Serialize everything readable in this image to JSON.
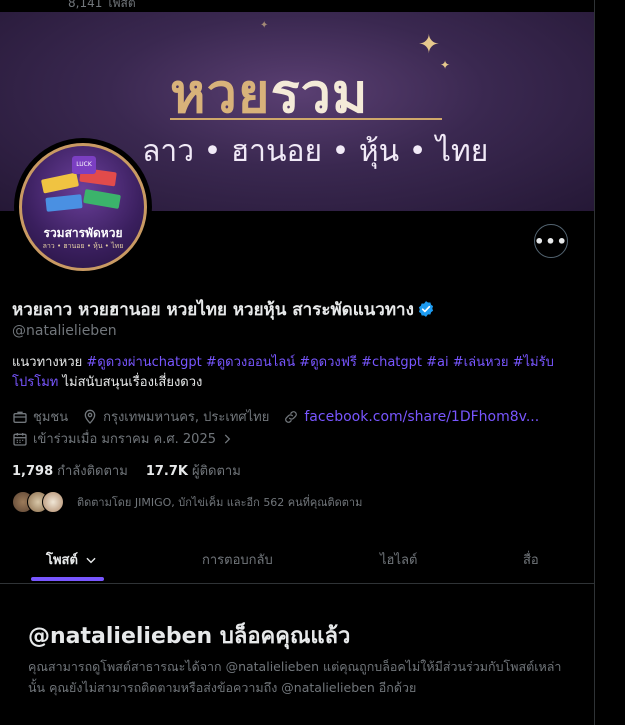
{
  "top": {
    "count_text": "8,141 โพสต์"
  },
  "banner": {
    "title_part1": "หวย",
    "title_part2": "รวม",
    "subtitle": "ลาว • ฮานอย • หุ้น • ไทย"
  },
  "avatar": {
    "badge_text": "LUCK",
    "name": "รวมสารพัดหวย",
    "sub": "ลาว • ฮานอย • หุ้น • ไทย"
  },
  "profile": {
    "display_name": "หวยลาว หวยฮานอย หวยไทย หวยหุ้น สาระพัดแนวทาง",
    "handle": "@natalielieben",
    "bio": {
      "prefix": "แนวทางหวย ",
      "hashtags": [
        "#ดูดวงผ่านchatgpt",
        "#ดูดวงออนไลน์",
        "#ดูดวงฟรี",
        "#chatgpt",
        "#ai",
        "#เล่นหวย",
        "#ไม่รับโปรโมท"
      ],
      "suffix": " ไม่สนับสนุนเรื่องเสี่ยงดวง"
    },
    "category": "ชุมชน",
    "location": "กรุงเทพมหานคร, ประเทศไทย",
    "website": "facebook.com/share/1DFhom8v...",
    "joined": "เข้าร่วมเมื่อ มกราคม ค.ศ. 2025",
    "following_count": "1,798",
    "following_label": "กำลังติดตาม",
    "followers_count": "17.7K",
    "followers_label": "ผู้ติดตาม",
    "followed_by": "ติดตามโดย JIMIGO, บักไข่เค็ม และอีก 562 คนที่คุณติดตาม"
  },
  "tabs": [
    {
      "label": "โพสต์"
    },
    {
      "label": "การตอบกลับ"
    },
    {
      "label": "ไฮไลต์"
    },
    {
      "label": "สื่อ"
    }
  ],
  "blocked": {
    "title": "@natalielieben บล็อคคุณแล้ว",
    "body": "คุณสามารถดูโพสต์สาธารณะได้จาก @natalielieben แต่คุณถูกบล็อคไม่ให้มีส่วนร่วมกับโพสต์เหล่านั้น คุณยังไม่สามารถติดตามหรือส่งข้อความถึง @natalielieben อีกด้วย"
  },
  "colors": {
    "accent": "#7856ff",
    "verified": "#1d9bf0",
    "muted": "#71767b",
    "text": "#e7e9ea"
  },
  "icons": [
    "briefcase-icon",
    "location-pin-icon",
    "link-icon",
    "calendar-icon",
    "chevron-right-icon",
    "chevron-down-icon",
    "verified-badge-icon",
    "more-options-icon"
  ]
}
